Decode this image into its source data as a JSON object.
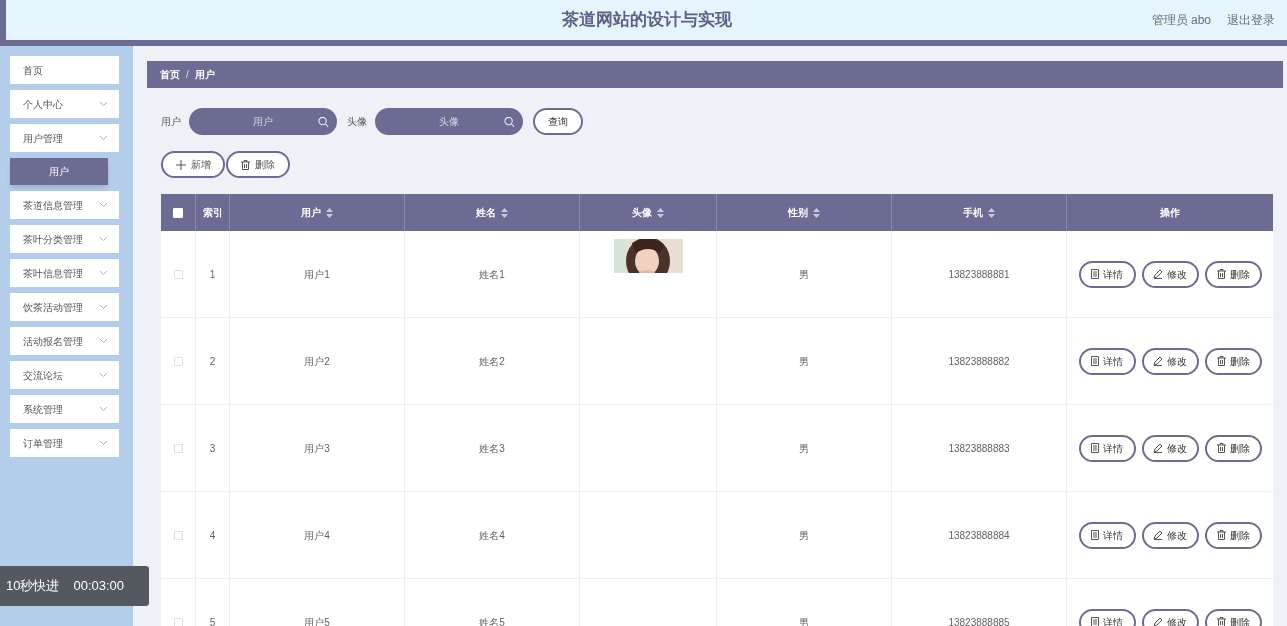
{
  "header": {
    "title": "茶道网站的设计与实现",
    "user": "管理员 abo",
    "logout": "退出登录"
  },
  "sidebar": {
    "items": [
      {
        "kind": "link",
        "label": "首页"
      },
      {
        "kind": "menu",
        "label": "个人中心"
      },
      {
        "kind": "menu",
        "label": "用户管理",
        "children": [
          {
            "label": "用户",
            "selected": true
          }
        ]
      },
      {
        "kind": "menu",
        "label": "茶道信息管理"
      },
      {
        "kind": "menu",
        "label": "茶叶分类管理"
      },
      {
        "kind": "menu",
        "label": "茶叶信息管理"
      },
      {
        "kind": "menu",
        "label": "饮茶活动管理"
      },
      {
        "kind": "menu",
        "label": "活动报名管理"
      },
      {
        "kind": "menu",
        "label": "交流论坛"
      },
      {
        "kind": "menu",
        "label": "系统管理"
      },
      {
        "kind": "menu",
        "label": "订单管理"
      }
    ]
  },
  "breadcrumb": {
    "items": [
      "首页",
      "用户"
    ],
    "separator": "/"
  },
  "search": {
    "fields": [
      {
        "label": "用户",
        "placeholder": "用户"
      },
      {
        "label": "头像",
        "placeholder": "头像"
      }
    ],
    "button": "查询"
  },
  "actions": [
    {
      "kind": "add",
      "label": "新增"
    },
    {
      "kind": "delete",
      "label": "删除"
    }
  ],
  "table": {
    "select_all": {
      "checked": false
    },
    "columns": [
      {
        "kind": "plain",
        "label": "索引"
      },
      {
        "kind": "sortable",
        "label": "用户"
      },
      {
        "kind": "sortable",
        "label": "姓名"
      },
      {
        "kind": "sortable",
        "label": "头像"
      },
      {
        "kind": "sortable",
        "label": "性别"
      },
      {
        "kind": "sortable",
        "label": "手机"
      },
      {
        "kind": "plain",
        "label": "操作"
      }
    ],
    "rows": [
      {
        "checked": false,
        "index": "1",
        "user": "用户1",
        "name": "姓名1",
        "gender": "男",
        "phone": "13823888881",
        "buttons": [
          {
            "kind": "detail",
            "label": "详情"
          },
          {
            "kind": "edit",
            "label": "修改"
          },
          {
            "kind": "delete",
            "label": "删除"
          }
        ]
      },
      {
        "checked": false,
        "index": "2",
        "user": "用户2",
        "name": "姓名2",
        "gender": "男",
        "phone": "13823888882",
        "buttons": [
          {
            "kind": "detail",
            "label": "详情"
          },
          {
            "kind": "edit",
            "label": "修改"
          },
          {
            "kind": "delete",
            "label": "删除"
          }
        ]
      },
      {
        "checked": false,
        "index": "3",
        "user": "用户3",
        "name": "姓名3",
        "gender": "男",
        "phone": "13823888883",
        "buttons": [
          {
            "kind": "detail",
            "label": "详情"
          },
          {
            "kind": "edit",
            "label": "修改"
          },
          {
            "kind": "delete",
            "label": "删除"
          }
        ]
      },
      {
        "checked": false,
        "index": "4",
        "user": "用户4",
        "name": "姓名4",
        "gender": "男",
        "phone": "13823888884",
        "buttons": [
          {
            "kind": "detail",
            "label": "详情"
          },
          {
            "kind": "edit",
            "label": "修改"
          },
          {
            "kind": "delete",
            "label": "删除"
          }
        ]
      },
      {
        "checked": false,
        "index": "5",
        "user": "用户5",
        "name": "姓名5",
        "gender": "男",
        "phone": "13823888885",
        "buttons": [
          {
            "kind": "detail",
            "label": "详情"
          },
          {
            "kind": "edit",
            "label": "修改"
          },
          {
            "kind": "delete",
            "label": "删除"
          }
        ]
      }
    ]
  },
  "player_overlay": {
    "label": "10秒快进",
    "time": "00:03:00"
  }
}
